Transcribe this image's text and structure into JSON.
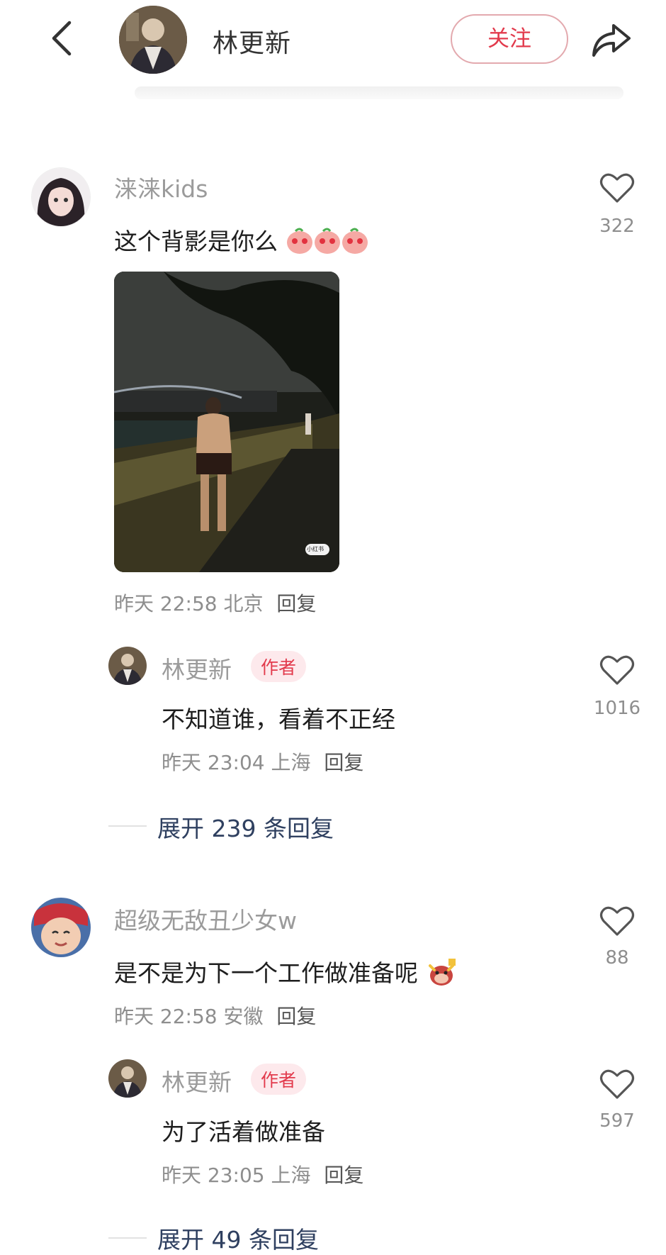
{
  "header": {
    "username": "林更新",
    "follow_label": "关注"
  },
  "comments": [
    {
      "user": "涞涞kids",
      "text": "这个背影是你么",
      "emojis": [
        "heart-eyes-peach-emoji",
        "heart-eyes-peach-emoji",
        "heart-eyes-peach-emoji"
      ],
      "has_photo": true,
      "photo_watermark": "小红书",
      "meta": {
        "time": "昨天 22:58",
        "location": "北京",
        "reply": "回复"
      },
      "likes": "322",
      "author_reply": {
        "user": "林更新",
        "badge": "作者",
        "text": "不知道谁，看着不正经",
        "meta": {
          "time": "昨天 23:04",
          "location": "上海",
          "reply": "回复"
        },
        "likes": "1016"
      },
      "expand": "展开 239 条回复"
    },
    {
      "user": "超级无敌丑少女w",
      "text": "是不是为下一个工作做准备呢",
      "emojis": [
        "ox-mascot-emoji"
      ],
      "has_photo": false,
      "meta": {
        "time": "昨天 22:58",
        "location": "安徽",
        "reply": "回复"
      },
      "likes": "88",
      "author_reply": {
        "user": "林更新",
        "badge": "作者",
        "text": "为了活着做准备",
        "meta": {
          "time": "昨天 23:05",
          "location": "上海",
          "reply": "回复"
        },
        "likes": "597"
      },
      "expand": "展开 49 条回复"
    }
  ],
  "colors": {
    "accent_red": "#e23a4c",
    "badge_bg": "#fde9ec",
    "expand_text": "#2f4060",
    "meta_gray": "#8e8e8e"
  }
}
